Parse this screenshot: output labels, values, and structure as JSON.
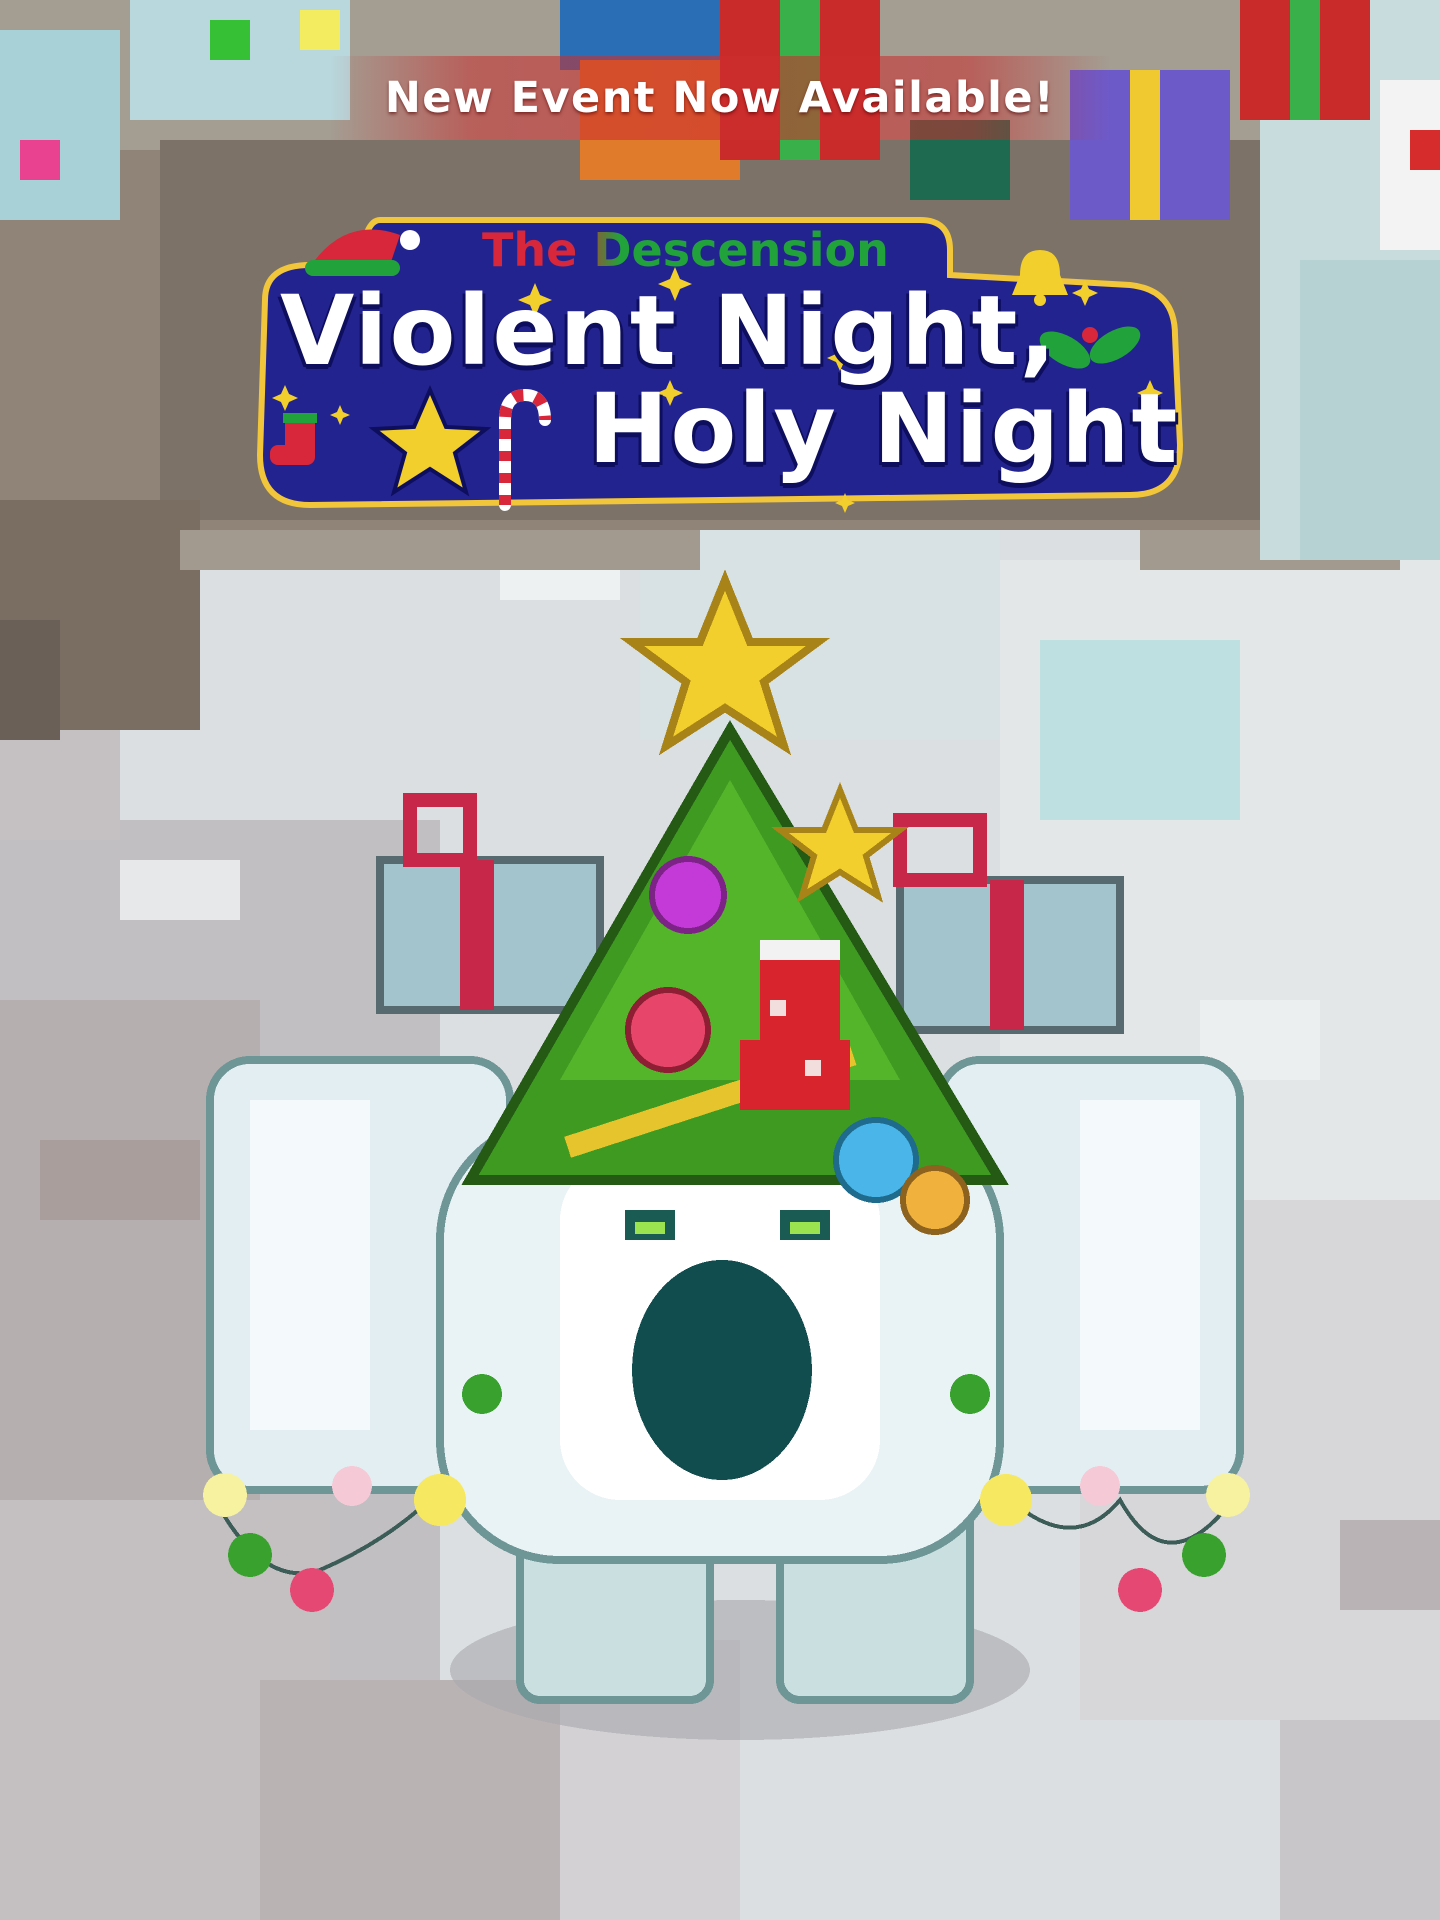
{
  "banner": {
    "text": "New Event Now Available!"
  },
  "logo": {
    "subtitle": "The Descension",
    "title_line1": "Violent Night,",
    "title_line2": "Holy Night"
  },
  "colors": {
    "banner_red": "#cd2d2d",
    "logo_navy": "#23238f",
    "logo_outline": "#f2c63a",
    "subtitle_red": "#d8263a",
    "subtitle_green": "#22a23b",
    "snow": "#dde3e3",
    "rock": "#8c7d72",
    "tree_green": "#3f9a22",
    "star_yellow": "#f2cf2c",
    "creature_body": "#e7eff3",
    "mouth_teal": "#114d4f"
  },
  "icons": [
    "santa-hat-icon",
    "bell-icon",
    "holly-icon",
    "stocking-icon",
    "star-icon",
    "candy-cane-icon",
    "sparkle-icon"
  ]
}
